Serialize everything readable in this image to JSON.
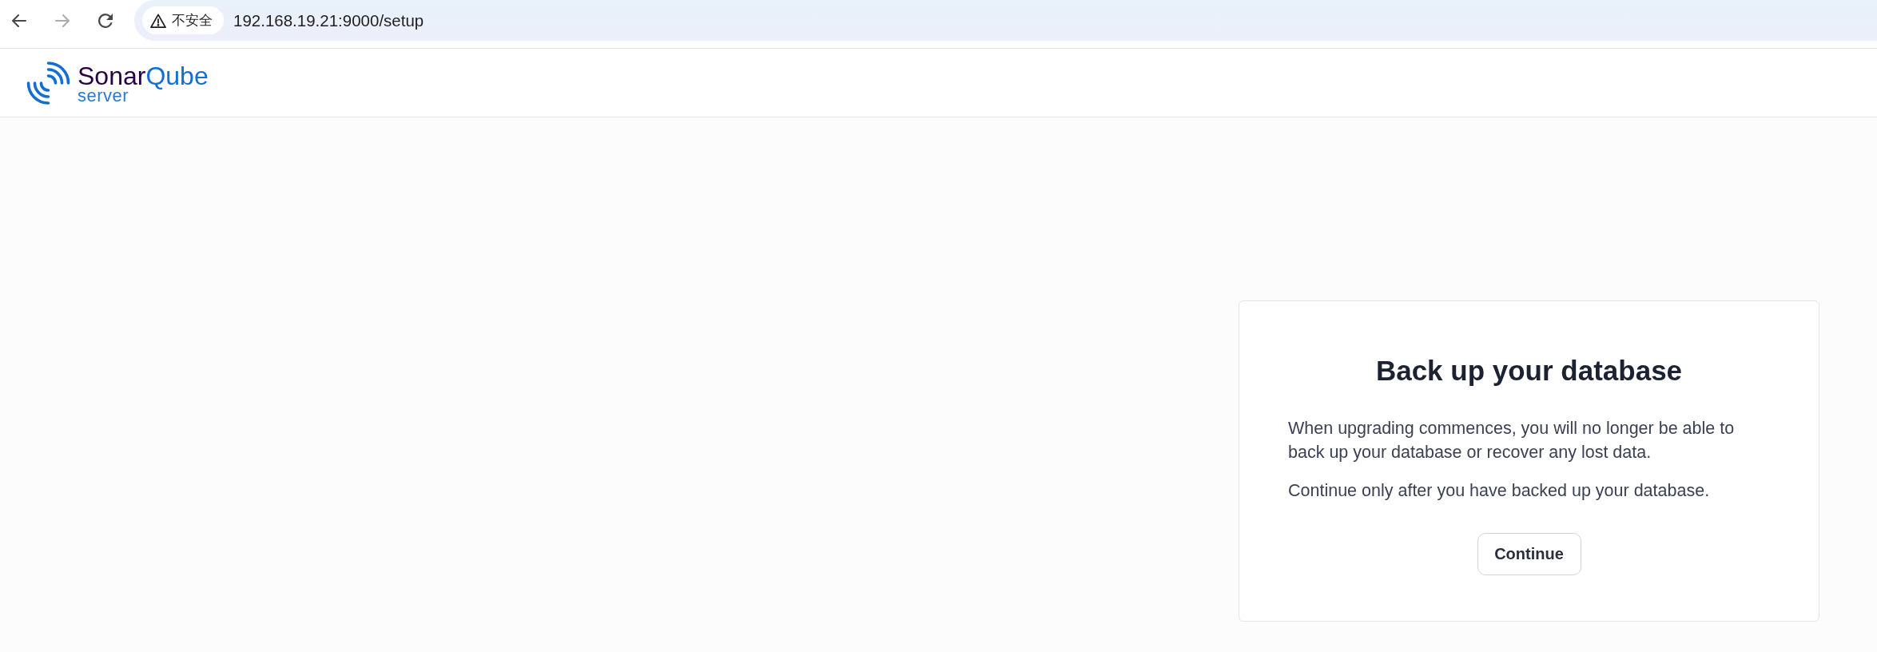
{
  "browser": {
    "nav_buttons": [
      {
        "kind": "back",
        "disabled": false
      },
      {
        "kind": "forward",
        "disabled": true
      },
      {
        "kind": "reload",
        "disabled": false
      }
    ],
    "security_chip": {
      "label": "不安全"
    },
    "url": "192.168.19.21:9000/setup"
  },
  "header": {
    "logo": {
      "name_parts": [
        {
          "text": "Sonar",
          "color": "#290042"
        },
        {
          "text": "Qube",
          "color": "#126ed3"
        }
      ],
      "edition": "server"
    }
  },
  "card": {
    "title": "Back up your database",
    "paragraphs": [
      "When upgrading commences, you will no longer be able to back up your database or recover any lost data.",
      "Continue only after you have backed up your database."
    ],
    "button": {
      "label": "Continue"
    }
  }
}
